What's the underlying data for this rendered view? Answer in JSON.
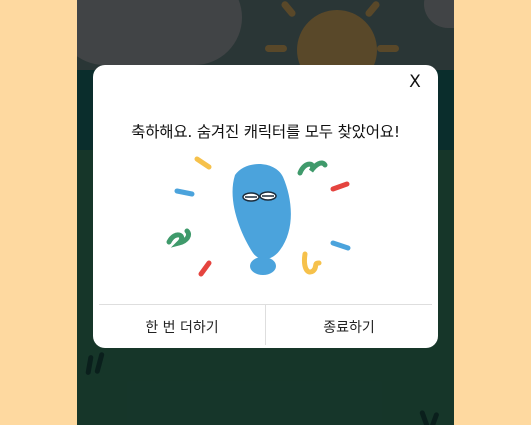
{
  "dialog": {
    "close_label": "X",
    "title": "축하해요. 숨겨진 캐릭터를 모두 찾았어요!",
    "buttons": {
      "play_again": "한 번 더하기",
      "quit": "종료하기"
    }
  },
  "colors": {
    "side_background": "#fed9a0",
    "character_blue": "#4ba3dc",
    "confetti_yellow": "#f6c14b",
    "confetti_green": "#3f9a6b",
    "confetti_red": "#e5443f",
    "confetti_blue": "#4ba3dc"
  }
}
